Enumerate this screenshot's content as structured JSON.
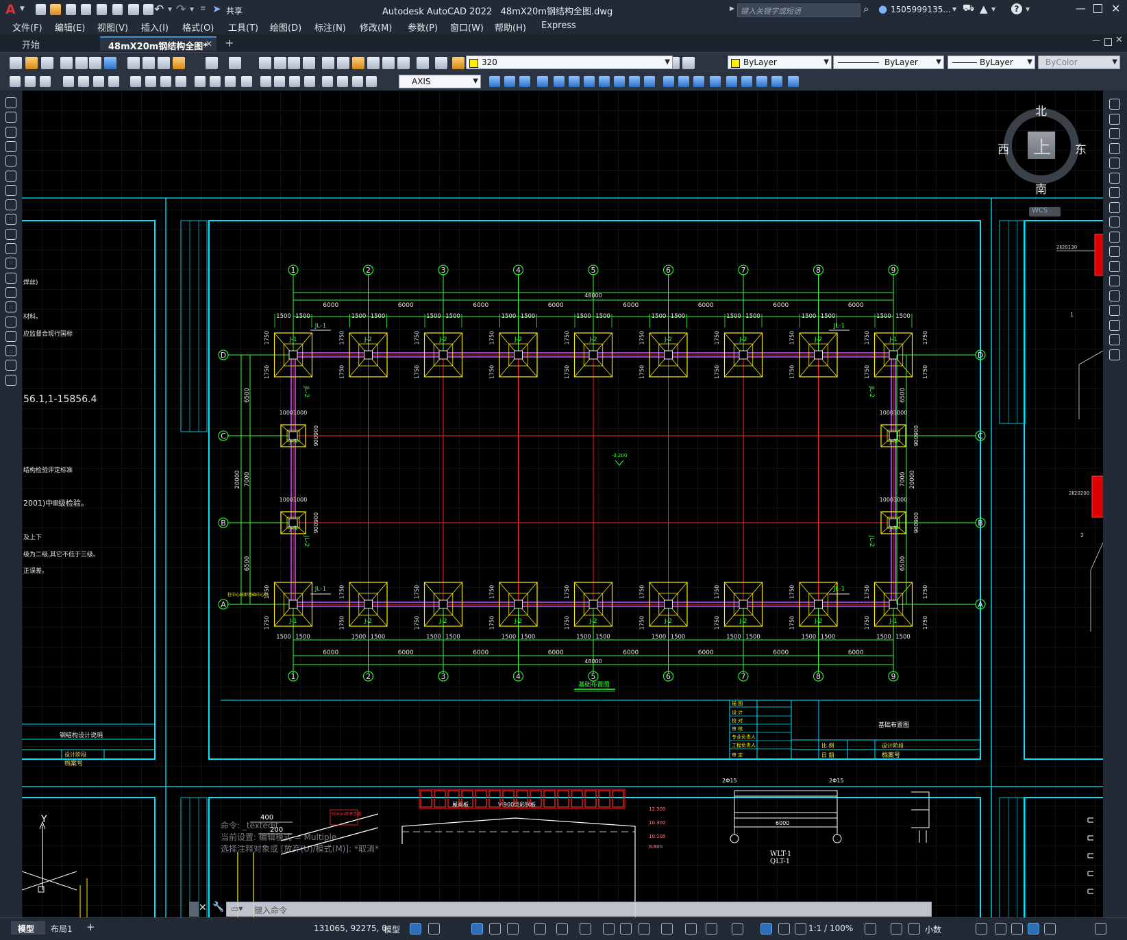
{
  "app": {
    "title": "Autodesk AutoCAD 2022",
    "filename": "48mX20m钢结构全图.dwg",
    "share_label": "共享",
    "search_placeholder": "键入关键字或短语",
    "user": "1505999135...",
    "logo": "A"
  },
  "menu": [
    "文件(F)",
    "编辑(E)",
    "视图(V)",
    "插入(I)",
    "格式(O)",
    "工具(T)",
    "绘图(D)",
    "标注(N)",
    "修改(M)",
    "参数(P)",
    "窗口(W)",
    "帮助(H)",
    "Express"
  ],
  "tabs": {
    "start": "开始",
    "doc": "48mX20m钢结构全图*"
  },
  "properties": {
    "layer": "320",
    "color": "ByLayer",
    "linetype": "ByLayer",
    "lineweight": "ByLayer",
    "plotstyle": "ByColor",
    "dimstyle": "AXIS",
    "layer_color": "#ffee00",
    "color_swatch": "#ffee00"
  },
  "viewcube": {
    "north": "北",
    "south": "南",
    "east": "东",
    "west": "西",
    "top": "上",
    "wcs": "WCS"
  },
  "drawing": {
    "plan_title": "基础布置图",
    "grid_cols": [
      "1",
      "2",
      "3",
      "4",
      "5",
      "6",
      "7",
      "8",
      "9"
    ],
    "grid_rows": [
      "D",
      "C",
      "B",
      "A"
    ],
    "bay": "6000",
    "total_length": "48000",
    "total_width": "20000",
    "side_bay": "6500",
    "mid_bay": "7000",
    "half_footing": "1500",
    "footing_depth": "1750",
    "gable_footing_w": "1000",
    "gable_footing_d": "900",
    "level": "-0.200",
    "note_bottom_left": "柱中心线即基础中心线",
    "beam_label": "JL-1",
    "beam_label_side": "JL-2",
    "foot_j1": "J-1",
    "foot_j2": "J-2",
    "foot_j3": "J-3",
    "title_block_rows": [
      "描 图",
      "设 计",
      "校 对",
      "审 核",
      "专业负责人",
      "工程负责人",
      "审 定"
    ],
    "title_block_right": [
      "比 例",
      "日 期"
    ],
    "title_block_name": "基础布置图",
    "design_phase": "设计阶段",
    "archive_no": "档案号",
    "left_sheet_title": "钢结构设计说明",
    "left_notes": [
      "焊丝)",
      "材料。",
      "应监督合现行国标",
      "56.1,1-15856.4",
      "结构检验评定标准",
      "2001)中Ⅲ级检验。",
      "及上下",
      "级为二级,其它不低于三级。",
      "正误差。"
    ],
    "bottom_labels": {
      "dim_400": "400",
      "dim_200": "200",
      "roof": "屋面板",
      "purlin": "V-900型彩钢板",
      "wl": "WLT-1",
      "ql": "QLT-1",
      "rebar1": "2Φ15",
      "rebar2": "2Φ15",
      "span": "6000",
      "y_axis": "Y",
      "levels": [
        "12.300",
        "10.300",
        "10.100",
        "8.800"
      ]
    }
  },
  "command": {
    "history": [
      "命令: _textedit",
      "当前设置: 编辑模式 = Multiple",
      "选择注释对象或 [放弃(U)/模式(M)]: *取消*"
    ],
    "prompt": "键入命令"
  },
  "status": {
    "model_tab": "模型",
    "layout_tab": "布局1",
    "coords": "131065, 92275, 0",
    "space": "模型",
    "scale": "1:1 / 100%",
    "units": "小数"
  }
}
